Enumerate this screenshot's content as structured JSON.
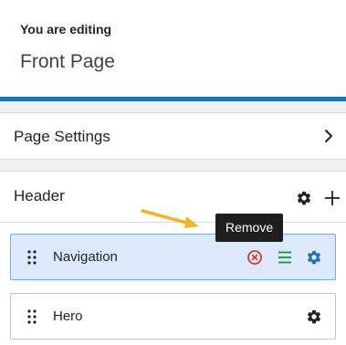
{
  "editing": {
    "label": "You are editing",
    "page_name": "Front Page"
  },
  "page_settings": {
    "label": "Page Settings",
    "icon": "chevron-right-icon"
  },
  "header": {
    "title": "Header",
    "actions": [
      "gear-icon",
      "plus-icon"
    ]
  },
  "blocks": [
    {
      "label": "Navigation",
      "selected": true,
      "actions": [
        "remove-icon",
        "list-icon",
        "gear-icon"
      ]
    },
    {
      "label": "Hero",
      "selected": false,
      "actions": [
        "gear-icon"
      ]
    }
  ],
  "tooltip": {
    "text": "Remove"
  },
  "colors": {
    "accent": "#2271b1",
    "remove": "#d63638",
    "list": "#00a32a",
    "gear_selected": "#2271b1",
    "gear_default": "#1d2327",
    "selected_bg": "#dbe9fb",
    "selected_border": "#72aee6",
    "annotation_arrow": "#f0b429",
    "tooltip_bg": "#1e1e1e"
  }
}
